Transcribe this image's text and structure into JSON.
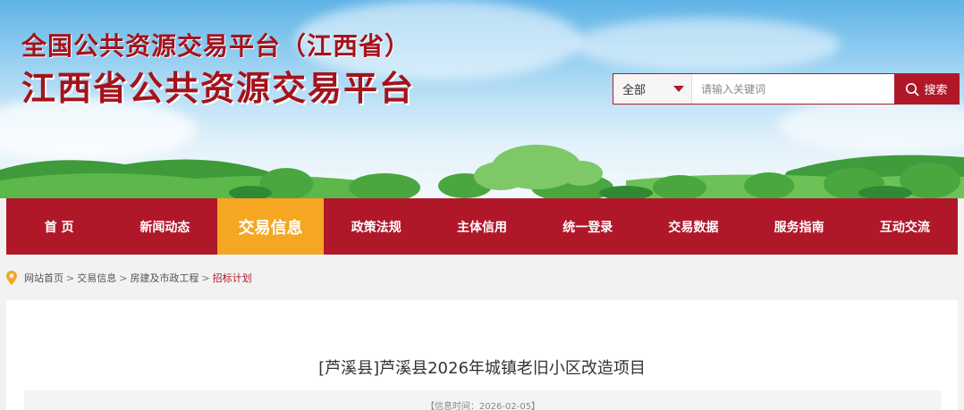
{
  "header": {
    "title_line1": "全国公共资源交易平台（江西省）",
    "title_line2": "江西省公共资源交易平台"
  },
  "search": {
    "scope": "全部",
    "placeholder": "请输入关键词",
    "button_label": "搜索"
  },
  "nav": {
    "items": [
      {
        "label": "首 页"
      },
      {
        "label": "新闻动态"
      },
      {
        "label": "交易信息"
      },
      {
        "label": "政策法规"
      },
      {
        "label": "主体信用"
      },
      {
        "label": "统一登录"
      },
      {
        "label": "交易数据"
      },
      {
        "label": "服务指南"
      },
      {
        "label": "互动交流"
      }
    ],
    "active_index": 2
  },
  "breadcrumb": {
    "items": [
      "网站首页",
      "交易信息",
      "房建及市政工程",
      "招标计划"
    ],
    "separators": [
      ">",
      ">",
      ">"
    ]
  },
  "article": {
    "title": "[芦溪县]芦溪县2026年城镇老旧小区改造项目",
    "meta": "【信息时间：2026-02-05】"
  },
  "colors": {
    "primary": "#b0182a",
    "active_tab": "#f5a623",
    "pin": "#f5a623"
  }
}
